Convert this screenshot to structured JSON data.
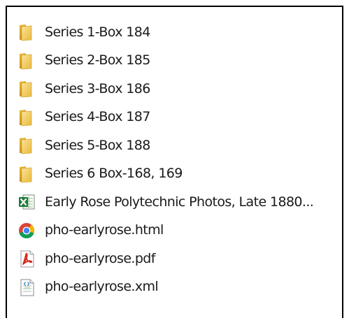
{
  "file_list": {
    "items": [
      {
        "label": "Series 1-Box 184",
        "icon": "folder-icon"
      },
      {
        "label": "Series 2-Box 185",
        "icon": "folder-icon"
      },
      {
        "label": "Series 3-Box 186",
        "icon": "folder-icon"
      },
      {
        "label": "Series 4-Box 187",
        "icon": "folder-icon"
      },
      {
        "label": "Series 5-Box 188",
        "icon": "folder-icon"
      },
      {
        "label": "Series 6 Box-168, 169",
        "icon": "folder-icon"
      },
      {
        "label": "Early Rose Polytechnic Photos, Late 1880...",
        "icon": "excel-file-icon"
      },
      {
        "label": "pho-earlyrose.html",
        "icon": "chrome-html-icon"
      },
      {
        "label": "pho-earlyrose.pdf",
        "icon": "pdf-file-icon"
      },
      {
        "label": "pho-earlyrose.xml",
        "icon": "xml-file-icon"
      }
    ]
  },
  "colors": {
    "folder_front": "#f2c94c",
    "folder_back": "#d9a520",
    "excel_green": "#1f7a3a",
    "pdf_red": "#d62b1f",
    "chrome_red": "#db4437",
    "chrome_yellow": "#f4b400",
    "chrome_green": "#0f9d58",
    "chrome_blue": "#4285f4"
  }
}
